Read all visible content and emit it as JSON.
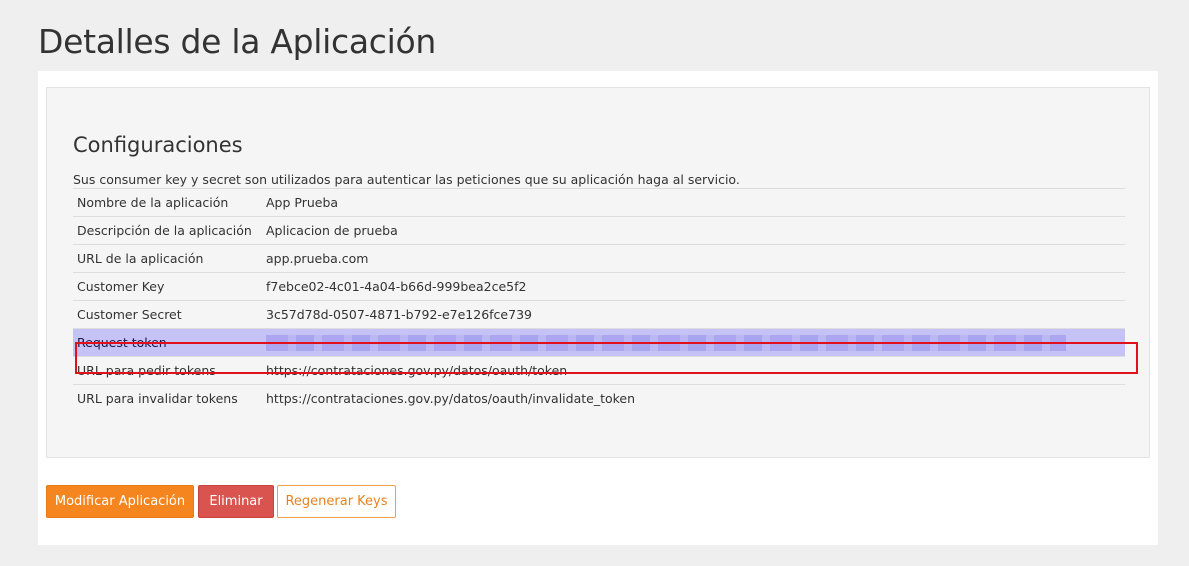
{
  "page": {
    "title": "Detalles de la Aplicación"
  },
  "config": {
    "title": "Configuraciones",
    "description": "Sus consumer key y secret son utilizados para autenticar las peticiones que su aplicación haga al servicio.",
    "rows": [
      {
        "label": "Nombre de la aplicación",
        "value": "App Prueba"
      },
      {
        "label": "Descripción de la aplicación",
        "value": "Aplicacion de prueba"
      },
      {
        "label": "URL de la aplicación",
        "value": "app.prueba.com"
      },
      {
        "label": "Customer Key",
        "value": "f7ebce02-4c01-4a04-b66d-999bea2ce5f2"
      },
      {
        "label": "Customer Secret",
        "value": "3c57d78d-0507-4871-b792-e7e126fce739"
      },
      {
        "label": "Request token",
        "value": ""
      },
      {
        "label": "URL para pedir tokens",
        "value": "https://contrataciones.gov.py/datos/oauth/token"
      },
      {
        "label": "URL para invalidar tokens",
        "value": "https://contrataciones.gov.py/datos/oauth/invalidate_token"
      }
    ]
  },
  "actions": {
    "modify_label": "Modificar Aplicación",
    "delete_label": "Eliminar",
    "regenerate_label": "Regenerar Keys"
  },
  "colors": {
    "accent_orange": "#f5861f",
    "danger_red": "#d9534f",
    "highlight_row": "#c5c2f6",
    "highlight_border": "#e0101c"
  }
}
